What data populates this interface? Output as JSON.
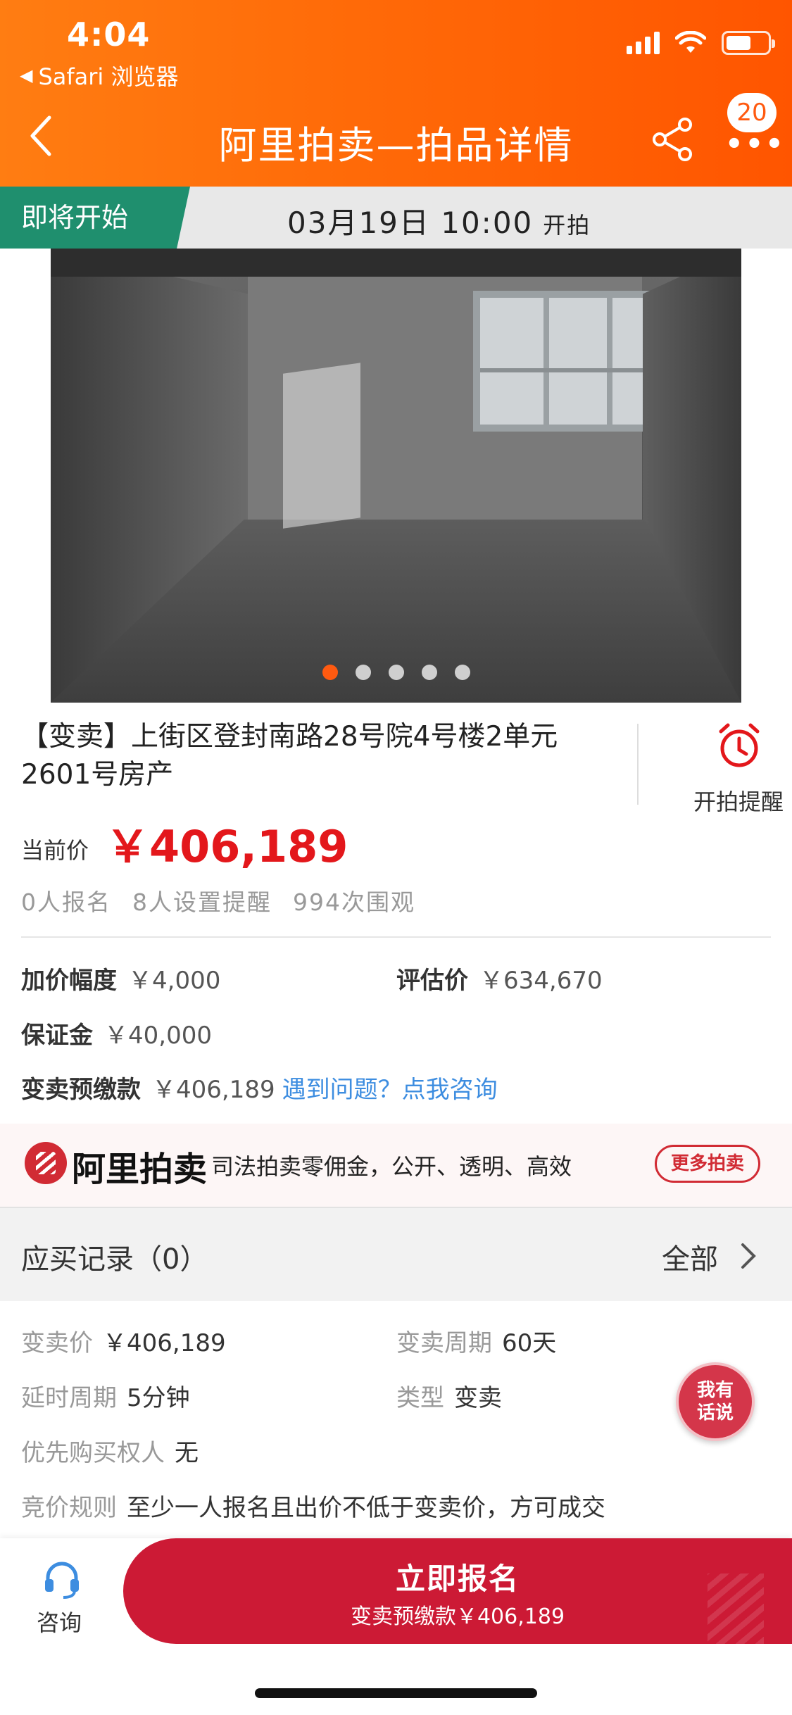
{
  "status_bar": {
    "time": "4:04",
    "back_app": "Safari 浏览器"
  },
  "nav": {
    "title": "阿里拍卖—拍品详情",
    "badge": "20",
    "more": "•••"
  },
  "auction_strip": {
    "tag": "即将开始",
    "date_time": "03月19日 10:00",
    "suffix": "开拍"
  },
  "gallery": {
    "slide_count": 5,
    "active_index": 0
  },
  "item": {
    "title": "【变卖】上街区登封南路28号院4号楼2单元2601号房产",
    "remind_label": "开拍提醒",
    "price_label": "当前价",
    "price": "￥406,189",
    "stats": [
      "0人报名",
      "8人设置提醒",
      "994次围观"
    ]
  },
  "info": {
    "increment_label": "加价幅度",
    "increment_value": "￥4,000",
    "appraisal_label": "评估价",
    "appraisal_value": "￥634,670",
    "deposit_label": "保证金",
    "deposit_value": "￥40,000",
    "prepay_label": "变卖预缴款",
    "prepay_value": "￥406,189",
    "help_link": "遇到问题？点我咨询"
  },
  "promo": {
    "brand": "阿里拍卖",
    "text": "司法拍卖零佣金，公开、透明、高效",
    "button": "更多拍卖"
  },
  "records": {
    "title": "应买记录（0）",
    "all_label": "全部"
  },
  "details": {
    "sale_price_label": "变卖价",
    "sale_price_value": "￥406,189",
    "period_label": "变卖周期",
    "period_value": "60天",
    "delay_label": "延时周期",
    "delay_value": "5分钟",
    "type_label": "类型",
    "type_value": "变卖",
    "priority_label": "优先购买权人",
    "priority_value": "无",
    "rule_label": "竞价规则",
    "rule_value": "至少一人报名且出价不低于变卖价，方可成交"
  },
  "float_talk": {
    "line1": "我有",
    "line2": "话说"
  },
  "bottom": {
    "consult_label": "咨询",
    "cta_main": "立即报名",
    "cta_sub": "变卖预缴款￥406,189"
  },
  "colors": {
    "header": "#ff6a08",
    "price": "#e3171b",
    "tag_green": "#1f8f6e",
    "cta": "#cc1a35",
    "link": "#3d8de0"
  }
}
